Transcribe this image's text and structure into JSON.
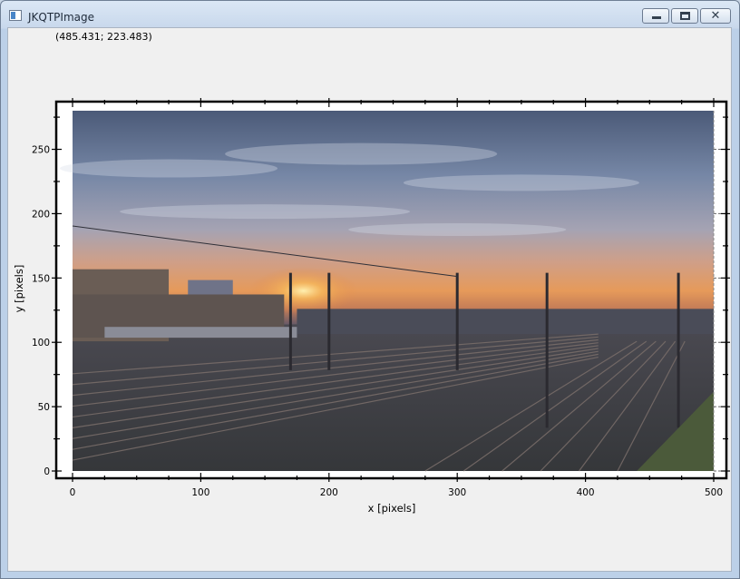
{
  "window": {
    "title": "JKQTPImage"
  },
  "status": {
    "mouse_position": "(485.431; 223.483)"
  },
  "plot": {
    "xlabel": "x [pixels]",
    "ylabel": "y [pixels]",
    "xlim": [
      0,
      500
    ],
    "ylim": [
      0,
      280
    ],
    "x_ticks": [
      "0",
      "100",
      "200",
      "300",
      "400",
      "500"
    ],
    "y_ticks": [
      "0",
      "50",
      "100",
      "150",
      "200",
      "250"
    ],
    "image": {
      "description": "sunset over railway yard",
      "x_range": [
        0,
        500
      ],
      "y_range": [
        0,
        280
      ]
    }
  },
  "icons": {
    "app": "app-window-icon",
    "minimize": "minimize-icon",
    "maximize": "maximize-icon",
    "close": "close-icon"
  },
  "colors": {
    "frame": "#000000",
    "client_bg": "#f0f0f0",
    "titlebar": "#c8d8ec"
  }
}
